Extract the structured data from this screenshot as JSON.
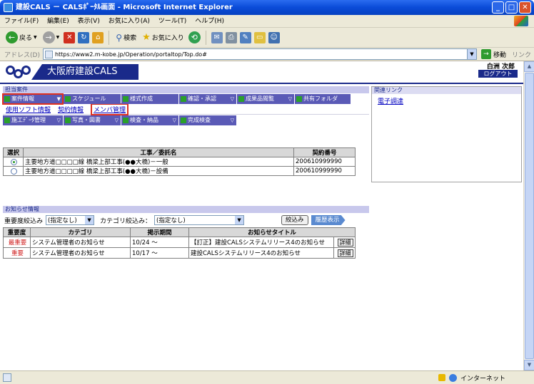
{
  "window": {
    "title": "建設CALS － CALSﾎﾟｰﾀﾙ画面 - Microsoft Internet Explorer"
  },
  "menubar": [
    "ファイル(F)",
    "編集(E)",
    "表示(V)",
    "お気に入り(A)",
    "ツール(T)",
    "ヘルプ(H)"
  ],
  "toolbar": {
    "back": "戻る",
    "search": "検索",
    "favorites": "お気に入り"
  },
  "address": {
    "label": "アドレス(D)",
    "url": "https://www2.m-kobe.jp/Operation/portaltop/Top.do#",
    "go": "移動",
    "links": "リンク"
  },
  "header": {
    "site_title": "大阪府建設CALS",
    "user_name": "白洲 次郎",
    "logout": "ログアウト"
  },
  "projects": {
    "section_title": "担当案件",
    "menu_row1": [
      {
        "label": "案件情報",
        "active": true,
        "dropdown": true
      },
      {
        "label": "スケジュール",
        "dropdown": false
      },
      {
        "label": "様式作成",
        "dropdown": false
      },
      {
        "label": "確認・承認",
        "dropdown": true
      },
      {
        "label": "成果品閲覧",
        "dropdown": true
      },
      {
        "label": "共有フォルダ",
        "dropdown": false
      }
    ],
    "sublinks": [
      {
        "label": "使用ソフト情報",
        "active": false
      },
      {
        "label": "契約情報",
        "active": false
      },
      {
        "label": "メンバ管理",
        "active": true
      }
    ],
    "menu_row2": [
      {
        "label": "施工ﾃﾞｰﾀ管理",
        "dropdown": true
      },
      {
        "label": "写真・図書",
        "dropdown": true
      },
      {
        "label": "検査・納品",
        "dropdown": true
      },
      {
        "label": "完成検査",
        "dropdown": true
      }
    ],
    "table": {
      "headers": [
        "選択",
        "工事／委託名",
        "契約番号"
      ],
      "rows": [
        {
          "selected": true,
          "name": "主要地方道□□□□線 橋梁上部工事(●●大橋)－一般",
          "contract": "200610999990"
        },
        {
          "selected": false,
          "name": "主要地方道□□□□線 橋梁上部工事(●●大橋)－設備",
          "contract": "200610999990"
        }
      ]
    }
  },
  "related": {
    "section_title": "関連リンク",
    "links": [
      "電子調達"
    ]
  },
  "notices": {
    "section_title": "お知らせ情報",
    "importance_label": "重要度絞込み",
    "importance_value": "(指定なし)",
    "category_label": "カテゴリ絞込み：",
    "category_value": "(指定なし)",
    "filter_button": "絞込み",
    "history_button": "履歴表示",
    "headers": [
      "重要度",
      "カテゴリ",
      "掲示期間",
      "お知らせタイトル"
    ],
    "rows": [
      {
        "importance": "最重要",
        "category": "システム管理者のお知らせ",
        "period": "10/24 ～",
        "title": "【訂正】建設CALSシステムリリース4のお知らせ",
        "detail": "詳細"
      },
      {
        "importance": "重要",
        "category": "システム管理者のお知らせ",
        "period": "10/17 ～",
        "title": "建設CALSシステムリリース4のお知らせ",
        "detail": "詳細"
      }
    ]
  },
  "statusbar": {
    "zone": "インターネット"
  },
  "colors": {
    "titlebar": "#0a4bd8",
    "navy": "#1a2a8a",
    "tab": "#5a5ab6",
    "highlight": "#e03020"
  }
}
